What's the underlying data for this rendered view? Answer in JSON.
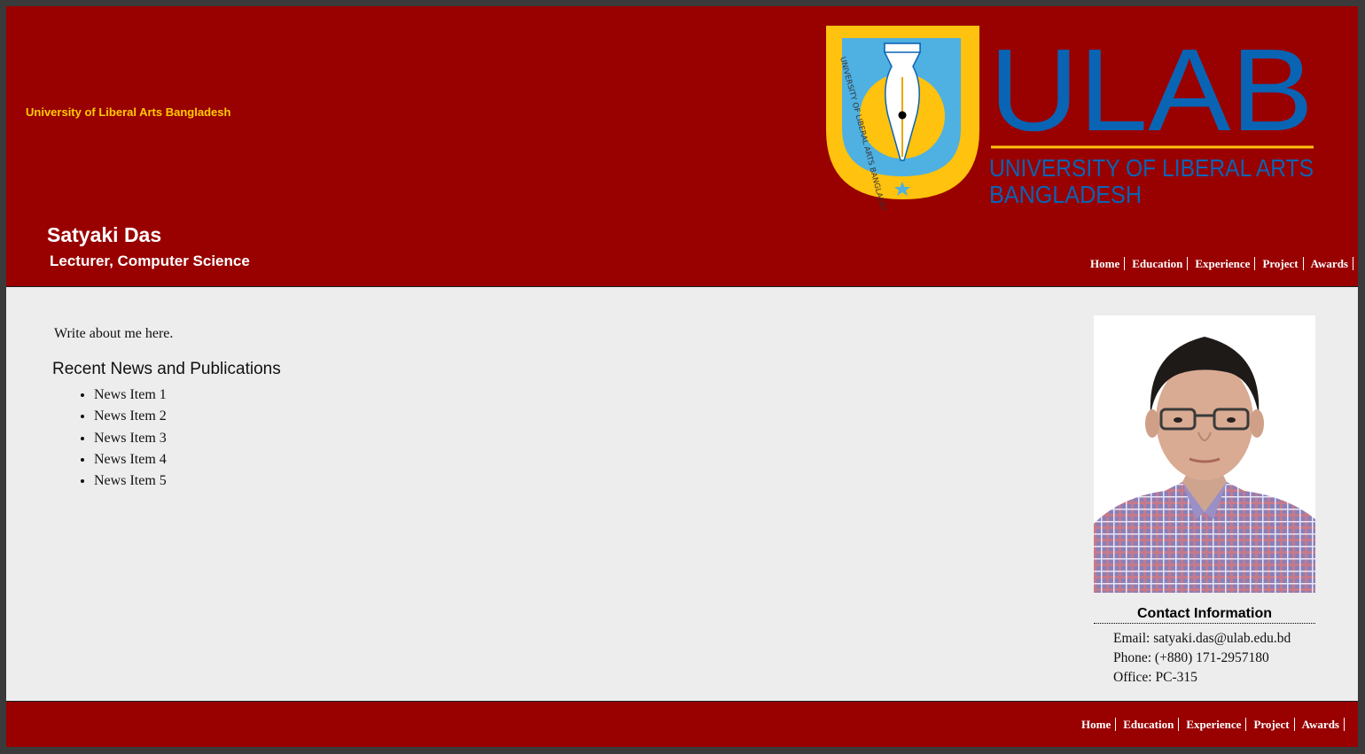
{
  "header": {
    "university_name": "University of Liberal Arts Bangladesh",
    "person_name": "Satyaki Das",
    "person_title": "Lecturer, Computer Science"
  },
  "logo": {
    "wordmark": "ULAB",
    "subtitle_line1": "UNIVERSITY OF LIBERAL ARTS",
    "subtitle_line2": "BANGLADESH",
    "crest_text": "UNIVERSITY OF LIBERAL ARTS BANGLADESH"
  },
  "nav": {
    "items": [
      {
        "label": "Home"
      },
      {
        "label": "Education"
      },
      {
        "label": "Experience"
      },
      {
        "label": "Project"
      },
      {
        "label": "Awards"
      }
    ]
  },
  "main": {
    "about_text": "Write about me here.",
    "news_heading": "Recent News and Publications",
    "news_items": [
      "News Item 1",
      "News Item 2",
      "News Item 3",
      "News Item 4",
      "News Item 5"
    ]
  },
  "contact": {
    "heading": "Contact Information",
    "email": "Email: satyaki.das@ulab.edu.bd",
    "phone": "Phone: (+880) 171-2957180",
    "office": "Office: PC-315"
  },
  "colors": {
    "header_bg": "#990000",
    "university_name": "#ffcc00",
    "logo_blue": "#0a64b4",
    "logo_gold": "#ffc20e",
    "page_bg": "#ededed"
  }
}
